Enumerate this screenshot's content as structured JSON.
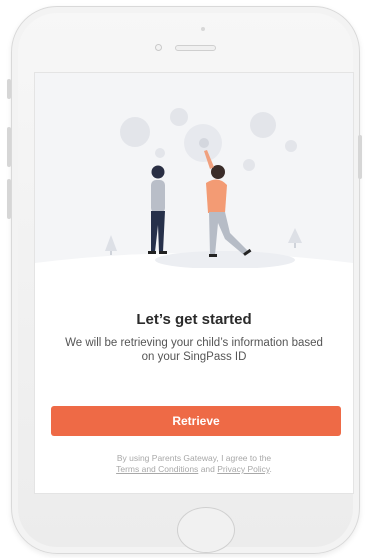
{
  "screen": {
    "title": "Let’s get started",
    "subtitle": "We will be retrieving your child’s information based on your SingPass ID",
    "retrieve_label": "Retrieve",
    "disclaimer": {
      "prefix": "By using Parents Gateway, I agree to the",
      "terms_link": "Terms and Conditions",
      "conjunction": "and",
      "privacy_link": "Privacy Policy",
      "suffix": "."
    }
  },
  "colors": {
    "accent": "#ee6a46",
    "illustration_bg": "#f4f5f7"
  }
}
